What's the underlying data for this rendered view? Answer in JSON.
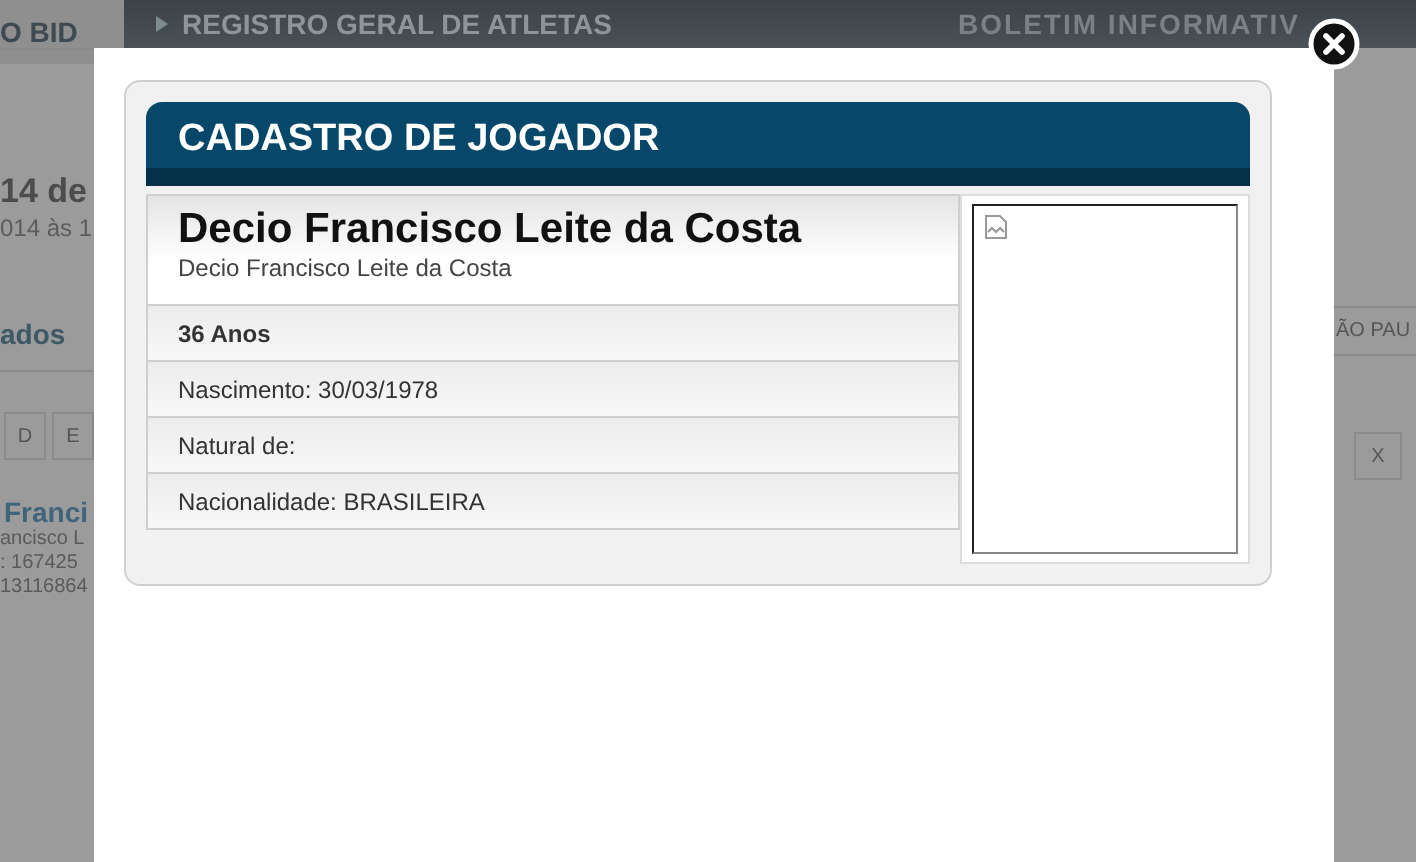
{
  "background_page": {
    "tab": "O BID",
    "breadcrumb": "REGISTRO GERAL DE ATLETAS",
    "banner": "BOLETIM INFORMATIV",
    "left_items": [
      {
        "kind": "heading",
        "text": "14 de"
      },
      {
        "kind": "subtitle",
        "text": "014 às 1"
      },
      {
        "kind": "section",
        "text": "ados"
      },
      {
        "kind": "letters",
        "letters": [
          "D",
          "E"
        ]
      },
      {
        "kind": "player",
        "text": "Franci"
      },
      {
        "kind": "line",
        "text": "ancisco L"
      },
      {
        "kind": "line",
        "text": ": 167425"
      },
      {
        "kind": "line",
        "text": "13116864"
      }
    ],
    "right_items": [
      {
        "kind": "section",
        "text": "ÃO PAU"
      },
      {
        "kind": "letters",
        "letters": [
          "X"
        ]
      }
    ]
  },
  "modal": {
    "title": "CADASTRO DE JOGADOR",
    "name": "Decio Francisco Leite da Costa",
    "full_name": "Decio Francisco Leite da Costa",
    "rows": [
      {
        "text": "36 Anos",
        "bold": true
      },
      {
        "text": "Nascimento: 30/03/1978",
        "bold": false
      },
      {
        "text": "Natural de:",
        "bold": false
      },
      {
        "text": "Nacionalidade: BRASILEIRA",
        "bold": false
      }
    ]
  }
}
